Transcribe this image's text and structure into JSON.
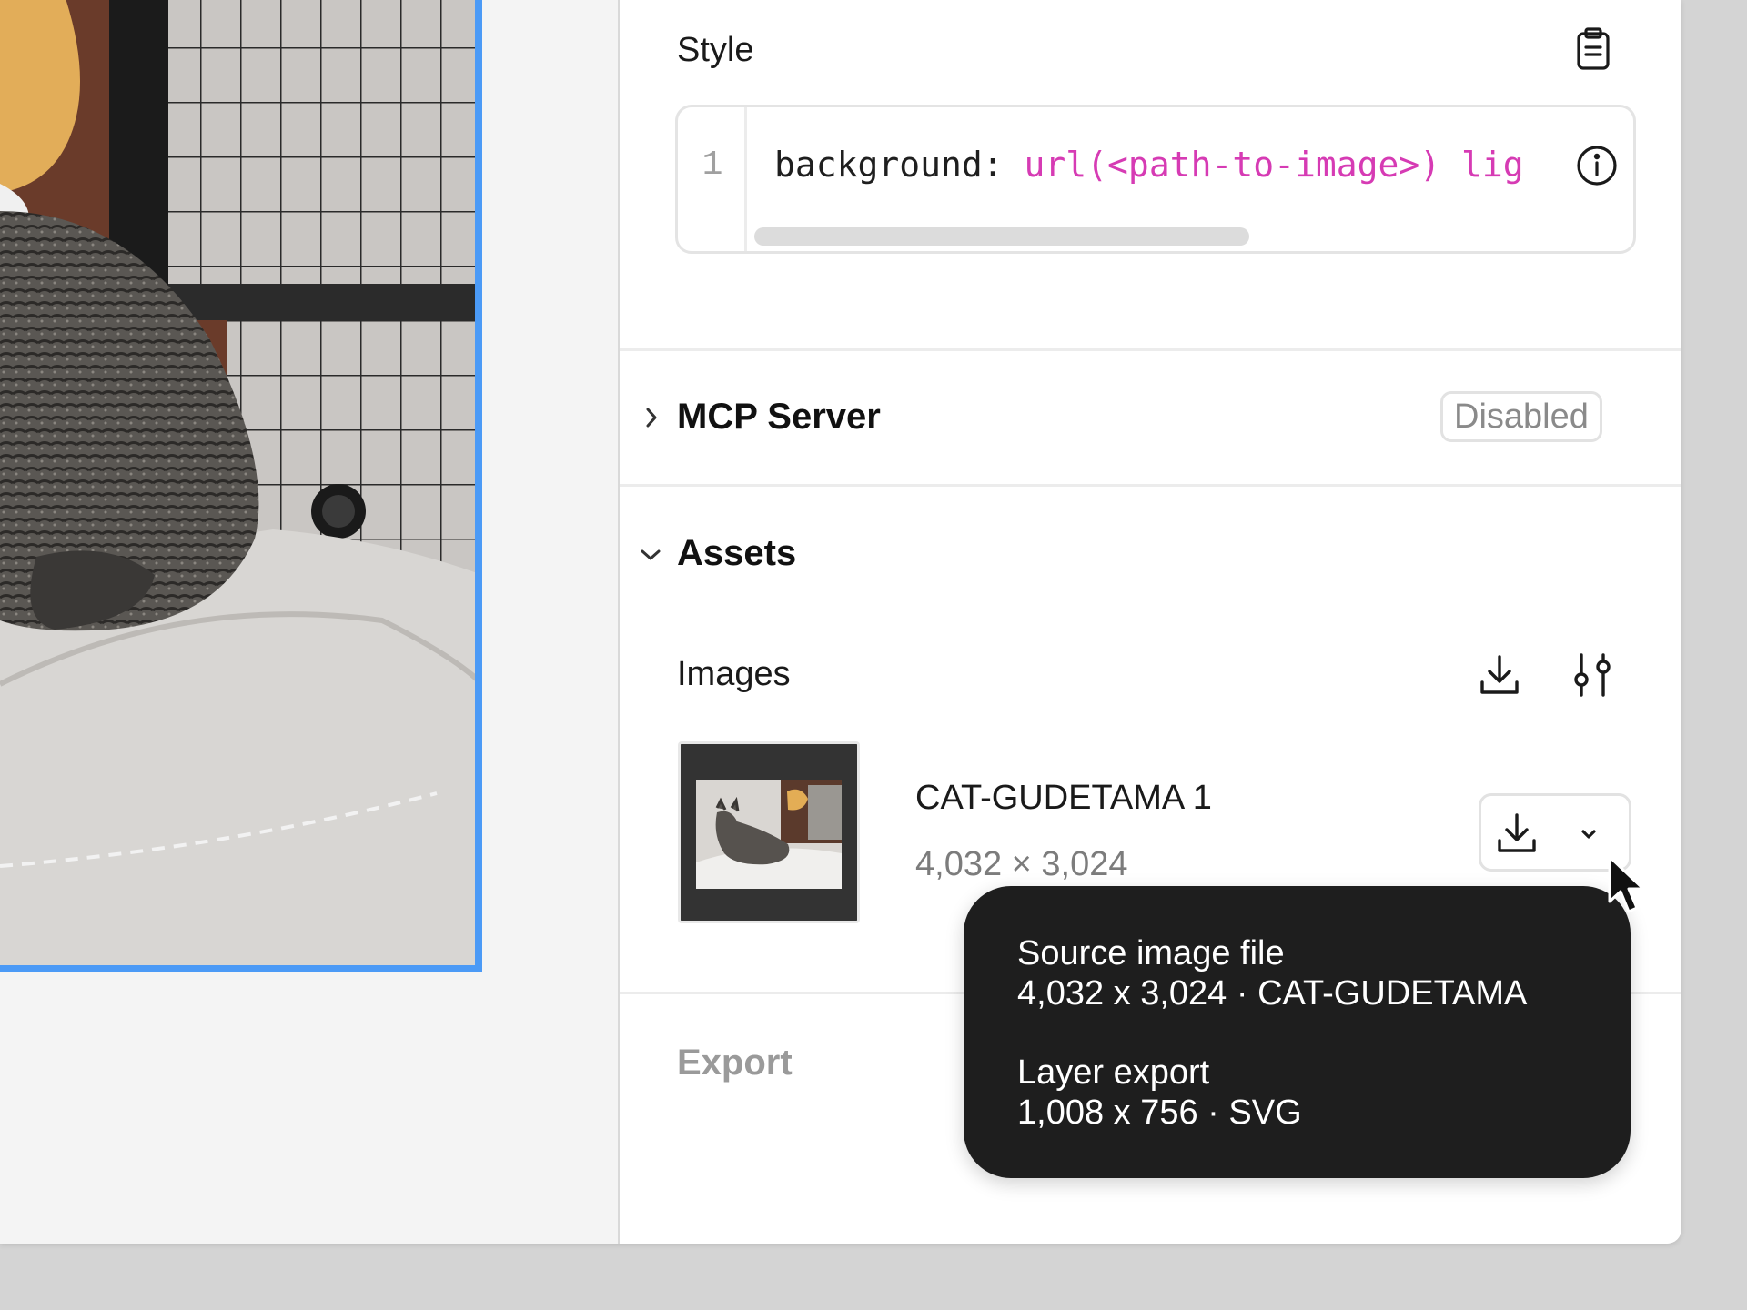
{
  "style_section": {
    "title": "Style",
    "code": {
      "line_number": "1",
      "property": "background: ",
      "value": "url(<path-to-image>) lig",
      "full_value": "url(<path-to-image>) lig"
    }
  },
  "mcp_section": {
    "title": "MCP Server",
    "status": "Disabled",
    "expanded": false
  },
  "assets_section": {
    "title": "Assets",
    "expanded": true,
    "images_label": "Images",
    "items": [
      {
        "name": "CAT-GUDETAMA 1",
        "dimensions": "4,032 × 3,024"
      }
    ]
  },
  "export_section": {
    "title": "Export"
  },
  "tooltip": {
    "line1": "Source image file",
    "line2": "4,032 x 3,024 · CAT-GUDETAMA",
    "line3": "Layer export",
    "line4": "1,008 x 756 · SVG"
  },
  "icons": {
    "style_copy": "clipboard-icon",
    "code_info": "info-icon",
    "mcp_toggle": "chevron-right-icon",
    "assets_toggle": "chevron-down-icon",
    "images_download": "download-icon",
    "images_settings": "sliders-icon",
    "asset_download": "download-icon",
    "asset_more": "chevron-down-icon",
    "cursor": "pointer-cursor-icon"
  },
  "colors": {
    "selection": "#4b9af6",
    "code_value": "#d63bb4",
    "tooltip_bg": "#1e1e1e"
  }
}
